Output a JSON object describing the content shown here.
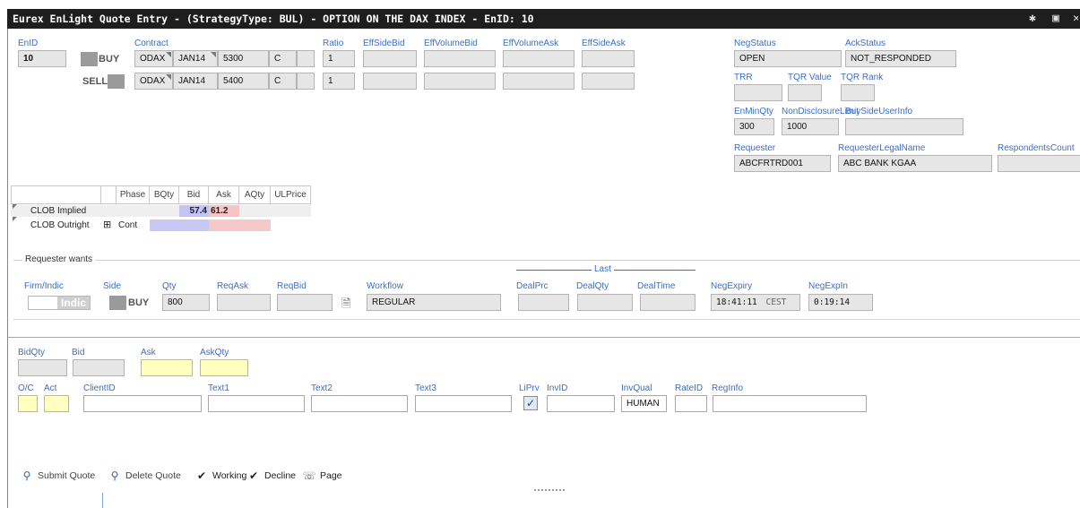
{
  "window": {
    "title": "Eurex EnLight Quote Entry - (StrategyType: BUL) - OPTION ON THE DAX INDEX - EnID: 10"
  },
  "header": {
    "enid_label": "EnID",
    "enid_value": "10",
    "contract_label": "Contract",
    "ratio_label": "Ratio",
    "effsidebid_label": "EffSideBid",
    "effvolumebid_label": "EffVolumeBid",
    "effvolumeask_label": "EffVolumeAsk",
    "effsideask_label": "EffSideAsk",
    "legs": [
      {
        "side": "BUY",
        "product": "ODAX",
        "expiry": "JAN14",
        "strike": "5300",
        "type": "C",
        "ratio": "1"
      },
      {
        "side": "SELL",
        "product": "ODAX",
        "expiry": "JAN14",
        "strike": "5400",
        "type": "C",
        "ratio": "1"
      }
    ]
  },
  "status_panel": {
    "negstatus_label": "NegStatus",
    "negstatus_value": "OPEN",
    "ackstatus_label": "AckStatus",
    "ackstatus_value": "NOT_RESPONDED",
    "trr_label": "TRR",
    "tqrvalue_label": "TQR Value",
    "tqrrank_label": "TQR Rank",
    "enminqty_label": "EnMinQty",
    "enminqty_value": "300",
    "nondisclosure_label": "NonDisclosureLimit",
    "nondisclosure_value": "1000",
    "buysideuserinfo_label": "BuySideUserInfo",
    "requester_label": "Requester",
    "requester_value": "ABCFRTRD001",
    "requesterlegalname_label": "RequesterLegalName",
    "requesterlegalname_value": "ABC BANK KGAA",
    "respondentscount_label": "RespondentsCount"
  },
  "clob": {
    "headers": [
      "Phase",
      "BQty",
      "Bid",
      "Ask",
      "AQty",
      "ULPrice"
    ],
    "rows": [
      {
        "name": "CLOB Implied",
        "phase": "",
        "bqty": "",
        "bid": "57.4",
        "ask": "61.2",
        "aqty": "",
        "ulprice": ""
      },
      {
        "name": "CLOB Outright",
        "expand": "⊞",
        "phase": "Cont",
        "bqty": "",
        "bid": "",
        "ask": "",
        "aqty": "",
        "ulprice": ""
      }
    ]
  },
  "requester_wants": {
    "legend": "Requester wants",
    "firm_indic_label": "Firm/Indic",
    "firm_indic_value": "Indic",
    "side_label": "Side",
    "side_value": "BUY",
    "qty_label": "Qty",
    "qty_value": "800",
    "reqask_label": "ReqAsk",
    "reqbid_label": "ReqBid",
    "workflow_label": "Workflow",
    "workflow_value": "REGULAR",
    "last_legend": "Last",
    "dealprc_label": "DealPrc",
    "dealqty_label": "DealQty",
    "dealtime_label": "DealTime",
    "negexpiry_label": "NegExpiry",
    "negexpiry_time": "18:41:11",
    "negexpiry_tz": "CEST",
    "negexpin_label": "NegExpIn",
    "negexpin_value": "0:19:14"
  },
  "quote_entry": {
    "bidqty_label": "BidQty",
    "bid_label": "Bid",
    "ask_label": "Ask",
    "askqty_label": "AskQty",
    "oc_label": "O/C",
    "act_label": "Act",
    "clientid_label": "ClientID",
    "text1_label": "Text1",
    "text2_label": "Text2",
    "text3_label": "Text3",
    "liprv_label": "LiPrv",
    "invid_label": "InvID",
    "invqual_label": "InvQual",
    "invqual_value": "HUMAN",
    "rateid_label": "RateID",
    "reginfo_label": "RegInfo"
  },
  "toolbar": {
    "submit_label": "Submit Quote",
    "delete_label": "Delete Quote",
    "working_label": "Working",
    "decline_label": "Decline",
    "page_label": "Page"
  },
  "colors": {
    "title_bg": "#1e1e1e",
    "label_blue": "#3b6ec6",
    "bid_bg": "#c3c3f5",
    "ask_bg": "#f7c3c3",
    "input_yellow": "#ffffc0"
  }
}
